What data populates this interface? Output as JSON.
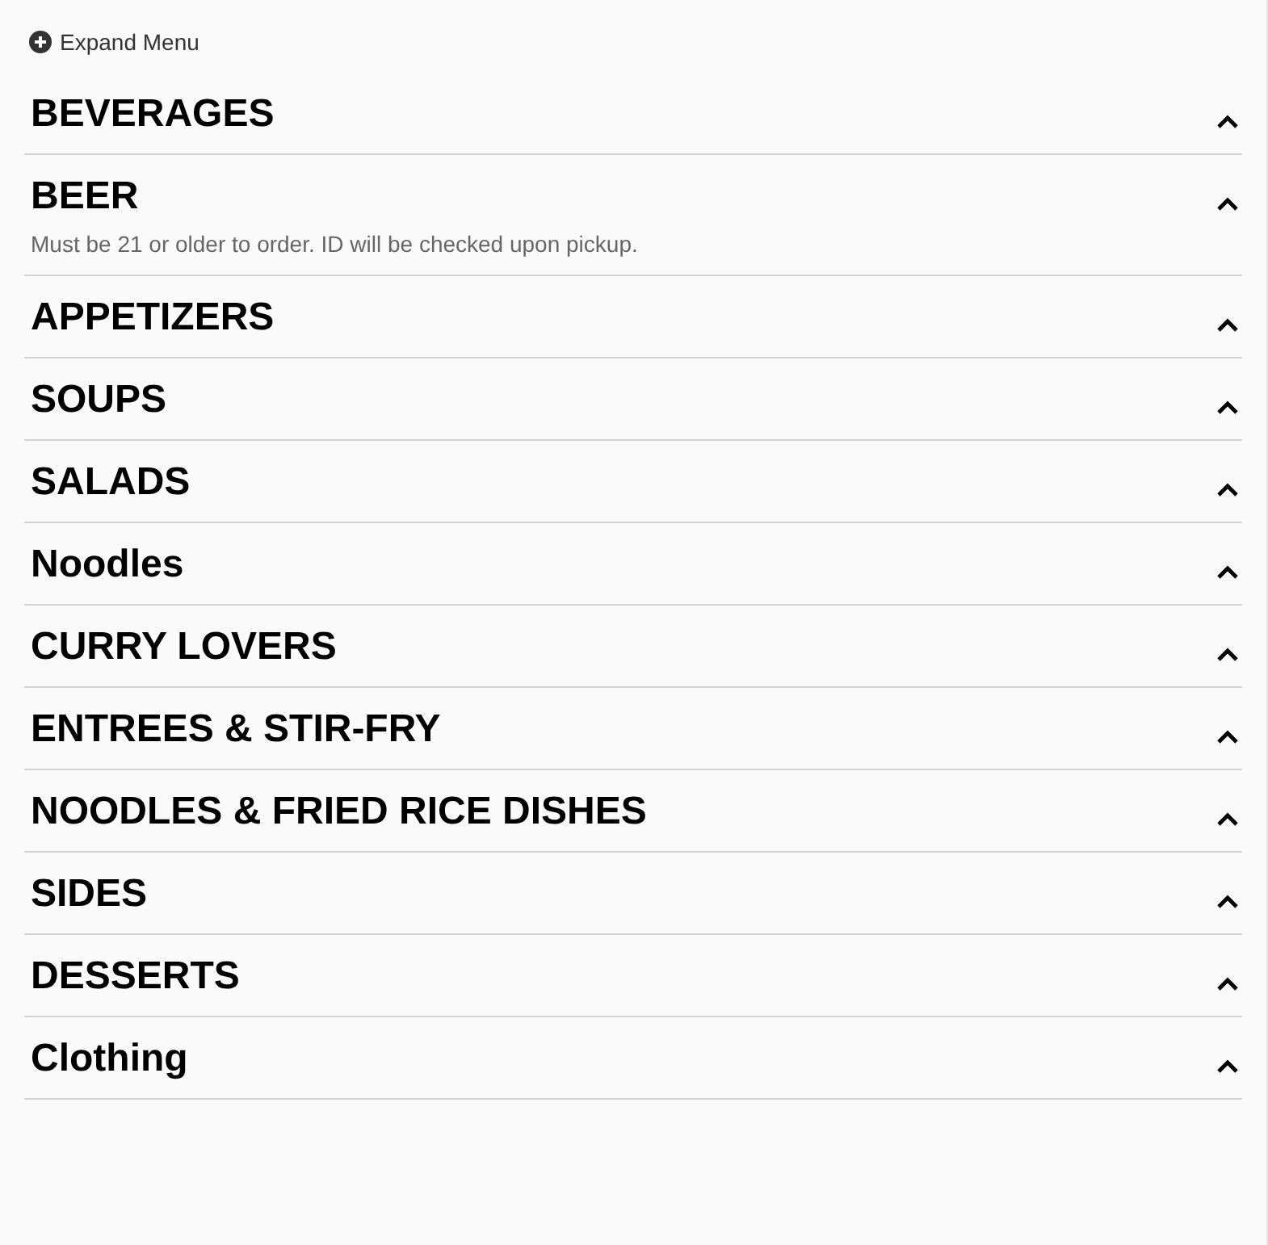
{
  "expand_menu": {
    "label": "Expand Menu"
  },
  "sections": [
    {
      "title": "BEVERAGES"
    },
    {
      "title": "BEER",
      "note": "Must be 21 or older to order. ID will be checked upon pickup."
    },
    {
      "title": "APPETIZERS"
    },
    {
      "title": "SOUPS"
    },
    {
      "title": "SALADS"
    },
    {
      "title": "Noodles"
    },
    {
      "title": "CURRY LOVERS"
    },
    {
      "title": "ENTREES & STIR-FRY"
    },
    {
      "title": "NOODLES & FRIED RICE DISHES"
    },
    {
      "title": "SIDES"
    },
    {
      "title": "DESSERTS"
    },
    {
      "title": "Clothing"
    }
  ]
}
